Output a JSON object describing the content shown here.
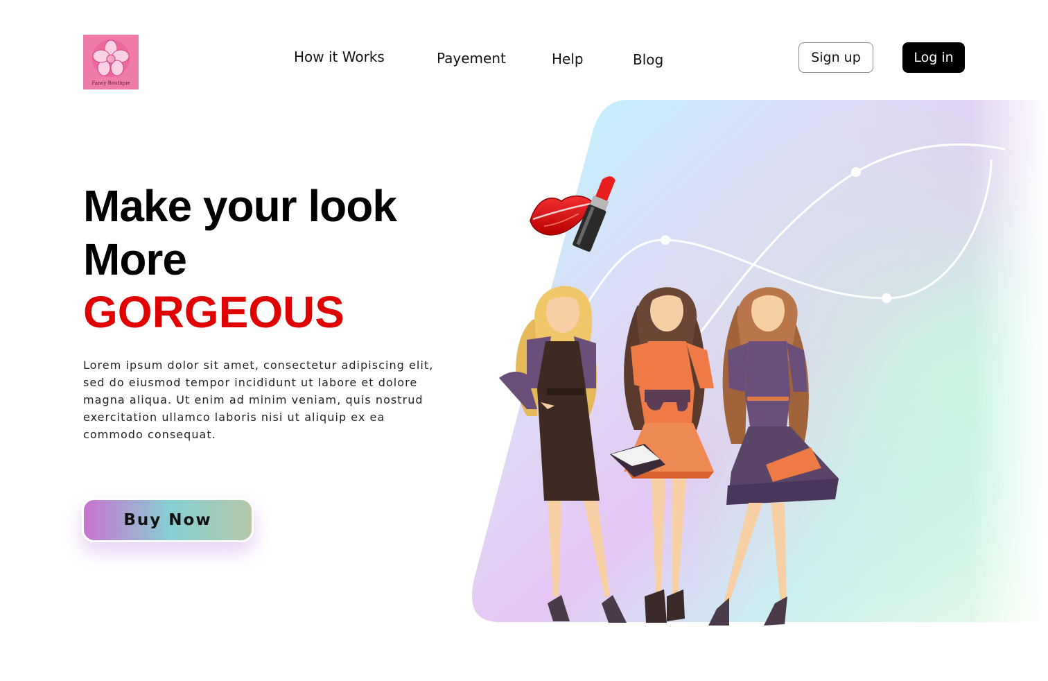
{
  "header": {
    "logo_text": "Fancy Boutique",
    "nav": [
      "How it Works",
      "Payement",
      "Help",
      "Blog"
    ],
    "signup_label": "Sign up",
    "login_label": "Log in"
  },
  "hero": {
    "title_line1": "Make your look",
    "title_line2": "More",
    "title_line3": "GORGEOUS",
    "description": "Lorem ipsum dolor sit amet, consectetur adipiscing elit, sed do eiusmod tempor incididunt ut labore et dolore magna aliqua. Ut enim ad minim veniam, quis nostrud exercitation ullamco laboris nisi ut aliquip ex ea commodo consequat.",
    "cta_label": "Buy Now"
  },
  "colors": {
    "accent_red": "#e00000",
    "logo_pink": "#f07aa8",
    "cta_gradient": [
      "#c874cf",
      "#86cfd3",
      "#b5c8a8"
    ],
    "login_bg": "#000000"
  },
  "icons": [
    "logo-flower-icon",
    "lips-icon",
    "lipstick-icon"
  ]
}
